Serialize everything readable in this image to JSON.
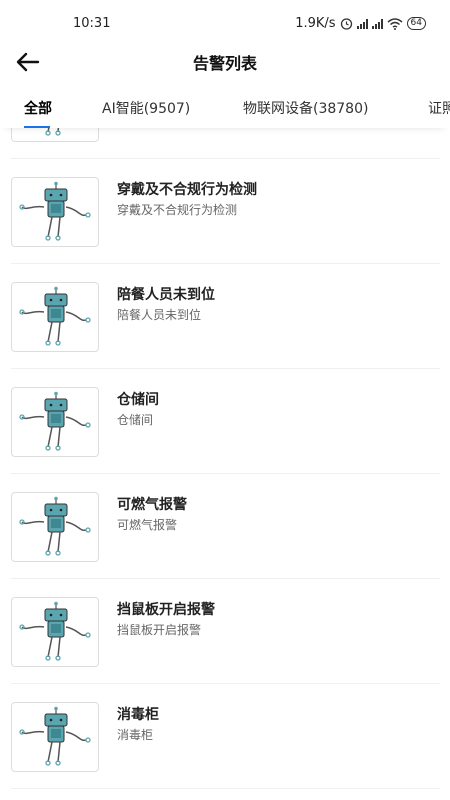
{
  "status_bar": {
    "time": "10:31",
    "net_speed": "1.9K/s",
    "battery": "64",
    "icons": [
      "alarm-icon",
      "signal-icon",
      "signal-icon",
      "wifi-icon",
      "battery-icon"
    ]
  },
  "nav": {
    "title": "告警列表",
    "back_icon": "arrow-left-icon"
  },
  "tabs": [
    {
      "label": "全部",
      "active": true
    },
    {
      "label": "AI智能(9507)",
      "active": false
    },
    {
      "label": "物联网设备(38780)",
      "active": false
    },
    {
      "label": "证照",
      "active": false
    }
  ],
  "colors": {
    "accent": "#1a73e8",
    "robot": "#5aa6b0"
  },
  "items": [
    {
      "title": "",
      "subtitle": "",
      "icon": "robot-icon"
    },
    {
      "title": "穿戴及不合规行为检测",
      "subtitle": "穿戴及不合规行为检测",
      "icon": "robot-icon"
    },
    {
      "title": "陪餐人员未到位",
      "subtitle": "陪餐人员未到位",
      "icon": "robot-icon"
    },
    {
      "title": "仓储间",
      "subtitle": "仓储间",
      "icon": "robot-icon"
    },
    {
      "title": "可燃气报警",
      "subtitle": "可燃气报警",
      "icon": "robot-icon"
    },
    {
      "title": "挡鼠板开启报警",
      "subtitle": "挡鼠板开启报警",
      "icon": "robot-icon"
    },
    {
      "title": "消毒柜",
      "subtitle": "消毒柜",
      "icon": "robot-icon"
    }
  ]
}
